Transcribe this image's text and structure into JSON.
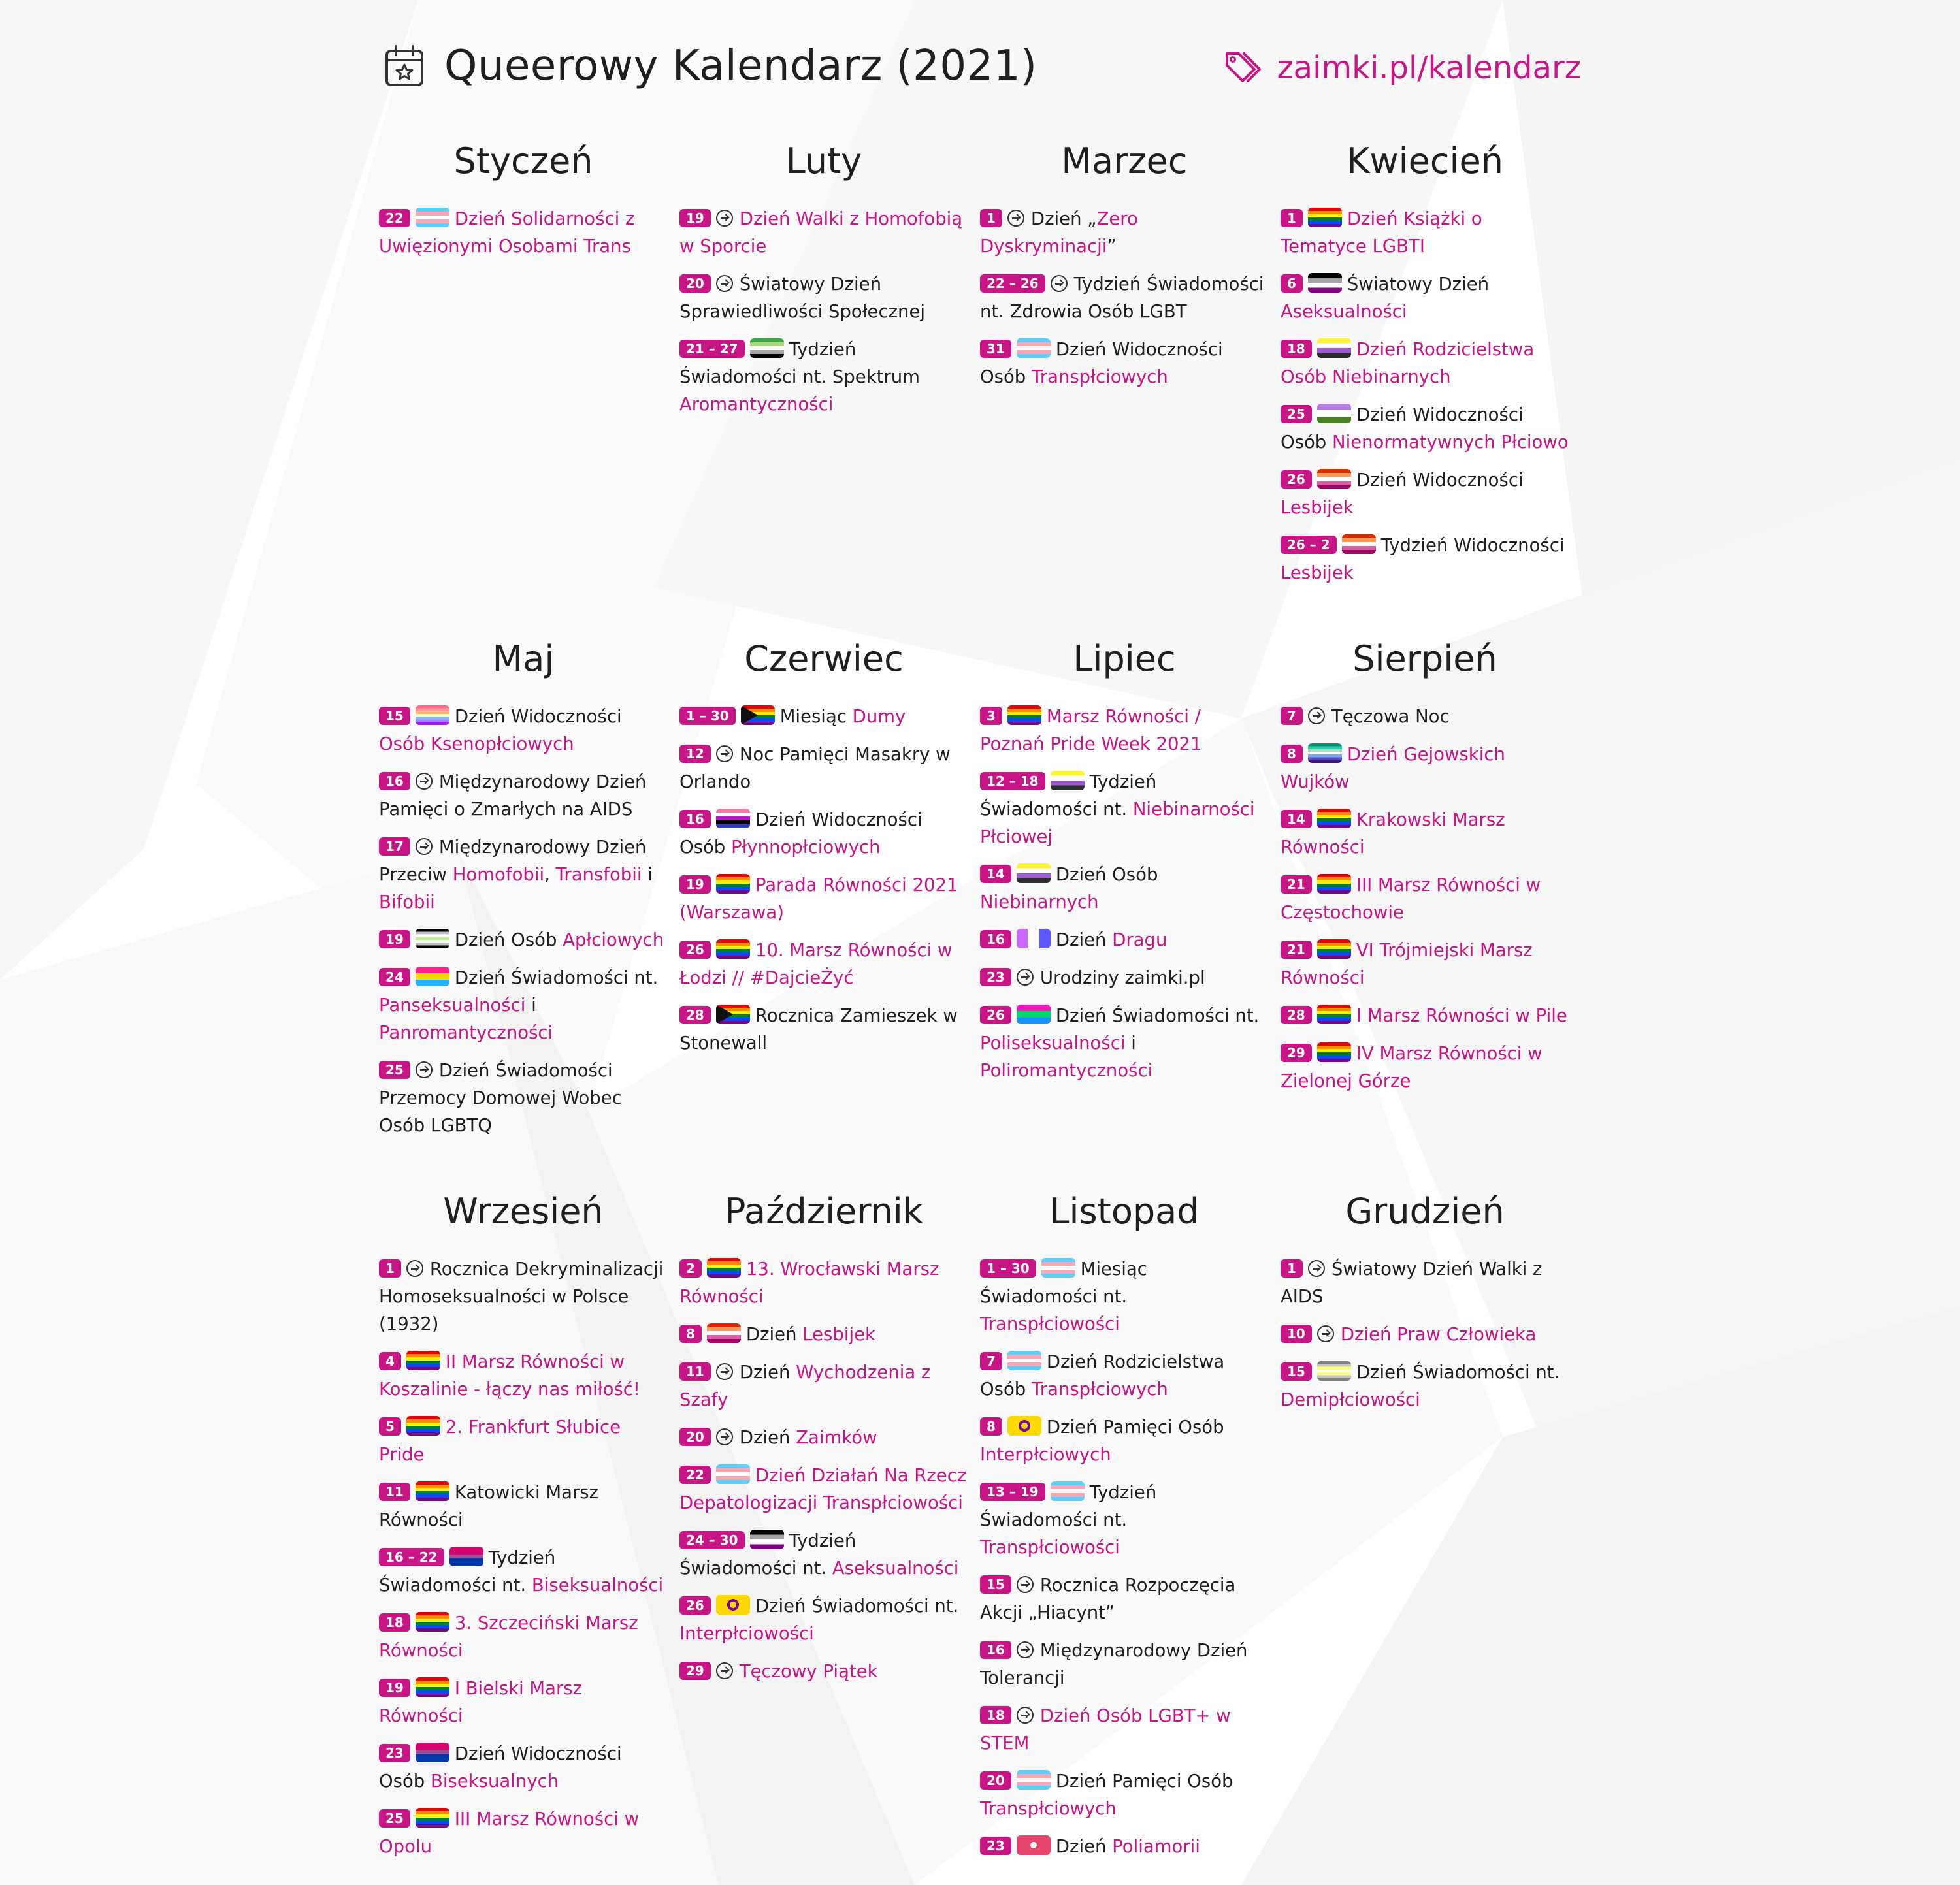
{
  "header": {
    "title": "Queerowy Kalendarz (2021)",
    "site": "zaimki.pl/kalendarz",
    "calendar_icon": "calendar-star-icon",
    "tag_icon": "tags-icon"
  },
  "colors": {
    "accent": "#c71585",
    "text": "#1f1f1f",
    "badge_text": "#ffffff"
  },
  "months": [
    {
      "name": "Styczeń",
      "events": [
        {
          "date": "22",
          "flag": "trans",
          "parts": [
            {
              "t": "Dzień Solidarności z Uwięzionymi Osobami Trans",
              "link": true
            }
          ]
        }
      ]
    },
    {
      "name": "Luty",
      "events": [
        {
          "date": "19",
          "flag": "arrow",
          "parts": [
            {
              "t": "Dzień Walki z Homofobią w Sporcie",
              "link": true
            }
          ]
        },
        {
          "date": "20",
          "flag": "arrow",
          "parts": [
            {
              "t": "Światowy Dzień Sprawiedliwości Społecznej",
              "link": false
            }
          ]
        },
        {
          "date": "21 – 27",
          "flag": "aromantic",
          "parts": [
            {
              "t": "Tydzień Świadomości nt. Spektrum ",
              "link": false
            },
            {
              "t": "Aromantyczności",
              "link": true
            }
          ]
        }
      ]
    },
    {
      "name": "Marzec",
      "events": [
        {
          "date": "1",
          "flag": "arrow",
          "parts": [
            {
              "t": "Dzień „",
              "link": false
            },
            {
              "t": "Zero Dyskryminacji",
              "link": true
            },
            {
              "t": "”",
              "link": false
            }
          ]
        },
        {
          "date": "22 – 26",
          "flag": "arrow",
          "parts": [
            {
              "t": "Tydzień Świadomości nt. Zdrowia Osób LGBT",
              "link": false
            }
          ]
        },
        {
          "date": "31",
          "flag": "trans",
          "parts": [
            {
              "t": "Dzień Widoczności Osób ",
              "link": false
            },
            {
              "t": "Transpłciowych",
              "link": true
            }
          ]
        }
      ]
    },
    {
      "name": "Kwiecień",
      "events": [
        {
          "date": "1",
          "flag": "rainbow",
          "parts": [
            {
              "t": "Dzień Książki o Tematyce LGBTI",
              "link": true
            }
          ]
        },
        {
          "date": "6",
          "flag": "asexual",
          "parts": [
            {
              "t": "Światowy Dzień ",
              "link": false
            },
            {
              "t": "Aseksualności",
              "link": true
            }
          ]
        },
        {
          "date": "18",
          "flag": "nonbinary",
          "parts": [
            {
              "t": "Dzień Rodzicielstwa Osób Niebinarnych",
              "link": true
            }
          ]
        },
        {
          "date": "25",
          "flag": "genderqueer",
          "parts": [
            {
              "t": "Dzień Widoczności Osób ",
              "link": false
            },
            {
              "t": "Nienormatywnych Płciowo",
              "link": true
            }
          ]
        },
        {
          "date": "26",
          "flag": "lesbian",
          "parts": [
            {
              "t": "Dzień Widoczności ",
              "link": false
            },
            {
              "t": "Lesbijek",
              "link": true
            }
          ]
        },
        {
          "date": "26 – 2",
          "flag": "lesbian",
          "parts": [
            {
              "t": "Tydzień Widoczności ",
              "link": false
            },
            {
              "t": "Lesbijek",
              "link": true
            }
          ]
        }
      ]
    },
    {
      "name": "Maj",
      "events": [
        {
          "date": "15",
          "flag": "xenogender",
          "parts": [
            {
              "t": "Dzień Widoczności ",
              "link": false
            },
            {
              "t": "Osób Ksenopłciowych",
              "link": true
            }
          ]
        },
        {
          "date": "16",
          "flag": "arrow",
          "parts": [
            {
              "t": "Międzynarodowy Dzień Pamięci o Zmarłych na AIDS",
              "link": false
            }
          ]
        },
        {
          "date": "17",
          "flag": "arrow",
          "parts": [
            {
              "t": "Międzynarodowy Dzień Przeciw ",
              "link": false
            },
            {
              "t": "Homofobii",
              "link": true
            },
            {
              "t": ", ",
              "link": false
            },
            {
              "t": "Transfobii",
              "link": true
            },
            {
              "t": " i ",
              "link": false
            },
            {
              "t": "Bifobii",
              "link": true
            }
          ]
        },
        {
          "date": "19",
          "flag": "agender",
          "parts": [
            {
              "t": "Dzień Osób ",
              "link": false
            },
            {
              "t": "Apłciowych",
              "link": true
            }
          ]
        },
        {
          "date": "24",
          "flag": "pansexual",
          "parts": [
            {
              "t": "Dzień Świadomości nt. ",
              "link": false
            },
            {
              "t": "Panseksualności",
              "link": true
            },
            {
              "t": " i ",
              "link": false
            },
            {
              "t": "Panromantyczności",
              "link": true
            }
          ]
        },
        {
          "date": "25",
          "flag": "arrow",
          "parts": [
            {
              "t": "Dzień Świadomości Przemocy Domowej Wobec Osób LGBTQ",
              "link": false
            }
          ]
        }
      ]
    },
    {
      "name": "Czerwiec",
      "events": [
        {
          "date": "1 – 30",
          "flag": "progress",
          "parts": [
            {
              "t": "Miesiąc ",
              "link": false
            },
            {
              "t": "Dumy",
              "link": true
            }
          ]
        },
        {
          "date": "12",
          "flag": "arrow",
          "parts": [
            {
              "t": "Noc Pamięci Masakry w Orlando",
              "link": false
            }
          ]
        },
        {
          "date": "16",
          "flag": "genderfluid",
          "parts": [
            {
              "t": "Dzień Widoczności Osób ",
              "link": false
            },
            {
              "t": "Płynnopłciowych",
              "link": true
            }
          ]
        },
        {
          "date": "19",
          "flag": "rainbow",
          "parts": [
            {
              "t": "Parada Równości 2021 (Warszawa)",
              "link": true
            }
          ]
        },
        {
          "date": "26",
          "flag": "rainbow",
          "parts": [
            {
              "t": "10. Marsz Równości w Łodzi // #DajcieŻyć",
              "link": true
            }
          ]
        },
        {
          "date": "28",
          "flag": "progress",
          "parts": [
            {
              "t": "Rocznica Zamieszek w Stonewall",
              "link": false
            }
          ]
        }
      ]
    },
    {
      "name": "Lipiec",
      "events": [
        {
          "date": "3",
          "flag": "rainbow",
          "parts": [
            {
              "t": "Marsz Równości / Poznań Pride Week 2021",
              "link": true
            }
          ]
        },
        {
          "date": "12 – 18",
          "flag": "nonbinary",
          "parts": [
            {
              "t": "Tydzień Świadomości nt. ",
              "link": false
            },
            {
              "t": "Niebinarności Płciowej",
              "link": true
            }
          ]
        },
        {
          "date": "14",
          "flag": "nonbinary",
          "parts": [
            {
              "t": "Dzień Osób ",
              "link": false
            },
            {
              "t": "Niebinarnych",
              "link": true
            }
          ]
        },
        {
          "date": "16",
          "flag": "drag",
          "parts": [
            {
              "t": "Dzień ",
              "link": false
            },
            {
              "t": "Dragu",
              "link": true
            }
          ]
        },
        {
          "date": "23",
          "flag": "arrow",
          "parts": [
            {
              "t": "Urodziny zaimki.pl",
              "link": false
            }
          ]
        },
        {
          "date": "26",
          "flag": "polysexual",
          "parts": [
            {
              "t": "Dzień Świadomości nt. ",
              "link": false
            },
            {
              "t": "Poliseksualności",
              "link": true
            },
            {
              "t": " i ",
              "link": false
            },
            {
              "t": "Poliromantyczności",
              "link": true
            }
          ]
        }
      ]
    },
    {
      "name": "Sierpień",
      "events": [
        {
          "date": "7",
          "flag": "arrow",
          "parts": [
            {
              "t": "Tęczowa Noc",
              "link": false
            }
          ]
        },
        {
          "date": "8",
          "flag": "gay",
          "parts": [
            {
              "t": "Dzień Gejowskich Wujków",
              "link": true
            }
          ]
        },
        {
          "date": "14",
          "flag": "rainbow",
          "parts": [
            {
              "t": "Krakowski Marsz Równości",
              "link": true
            }
          ]
        },
        {
          "date": "21",
          "flag": "rainbow",
          "parts": [
            {
              "t": "III Marsz Równości w Częstochowie",
              "link": true
            }
          ]
        },
        {
          "date": "21",
          "flag": "rainbow",
          "parts": [
            {
              "t": "VI Trójmiejski Marsz Równości",
              "link": true
            }
          ]
        },
        {
          "date": "28",
          "flag": "rainbow",
          "parts": [
            {
              "t": "I Marsz Równości w Pile",
              "link": true
            }
          ]
        },
        {
          "date": "29",
          "flag": "rainbow",
          "parts": [
            {
              "t": "IV Marsz Równości w Zielonej Górze",
              "link": true
            }
          ]
        }
      ]
    },
    {
      "name": "Wrzesień",
      "events": [
        {
          "date": "1",
          "flag": "arrow",
          "parts": [
            {
              "t": "Rocznica Dekryminalizacji Homoseksualności w Polsce (1932)",
              "link": false
            }
          ]
        },
        {
          "date": "4",
          "flag": "rainbow",
          "parts": [
            {
              "t": "II Marsz Równości w Koszalinie - łączy nas miłość!",
              "link": true
            }
          ]
        },
        {
          "date": "5",
          "flag": "rainbow",
          "parts": [
            {
              "t": "2. Frankfurt Słubice Pride",
              "link": true
            }
          ]
        },
        {
          "date": "11",
          "flag": "rainbow",
          "parts": [
            {
              "t": "Katowicki Marsz Równości",
              "link": false
            }
          ]
        },
        {
          "date": "16 – 22",
          "flag": "bisexual",
          "parts": [
            {
              "t": "Tydzień Świadomości nt. ",
              "link": false
            },
            {
              "t": "Biseksualności",
              "link": true
            }
          ]
        },
        {
          "date": "18",
          "flag": "rainbow",
          "parts": [
            {
              "t": "3. Szczeciński Marsz Równości",
              "link": true
            }
          ]
        },
        {
          "date": "19",
          "flag": "rainbow",
          "parts": [
            {
              "t": "I Bielski Marsz Równości",
              "link": true
            }
          ]
        },
        {
          "date": "23",
          "flag": "bisexual",
          "parts": [
            {
              "t": "Dzień Widoczności Osób ",
              "link": false
            },
            {
              "t": "Biseksualnych",
              "link": true
            }
          ]
        },
        {
          "date": "25",
          "flag": "rainbow",
          "parts": [
            {
              "t": "III Marsz Równości w Opolu",
              "link": true
            }
          ]
        }
      ]
    },
    {
      "name": "Październik",
      "events": [
        {
          "date": "2",
          "flag": "rainbow",
          "parts": [
            {
              "t": "13. Wrocławski Marsz Równości",
              "link": true
            }
          ]
        },
        {
          "date": "8",
          "flag": "lesbian",
          "parts": [
            {
              "t": "Dzień ",
              "link": false
            },
            {
              "t": "Lesbijek",
              "link": true
            }
          ]
        },
        {
          "date": "11",
          "flag": "arrow",
          "parts": [
            {
              "t": "Dzień ",
              "link": false
            },
            {
              "t": "Wychodzenia z Szafy",
              "link": true
            }
          ]
        },
        {
          "date": "20",
          "flag": "arrow",
          "parts": [
            {
              "t": "Dzień ",
              "link": false
            },
            {
              "t": "Zaimków",
              "link": true
            }
          ]
        },
        {
          "date": "22",
          "flag": "trans",
          "parts": [
            {
              "t": "Dzień Działań Na Rzecz Depatologizacji Transpłciowości",
              "link": true
            }
          ]
        },
        {
          "date": "24 – 30",
          "flag": "asexual",
          "parts": [
            {
              "t": "Tydzień Świadomości nt. ",
              "link": false
            },
            {
              "t": "Aseksualności",
              "link": true
            }
          ]
        },
        {
          "date": "26",
          "flag": "intersex",
          "parts": [
            {
              "t": "Dzień Świadomości nt. ",
              "link": false
            },
            {
              "t": "Interpłciowości",
              "link": true
            }
          ]
        },
        {
          "date": "29",
          "flag": "arrow",
          "parts": [
            {
              "t": "Tęczowy Piątek",
              "link": true
            }
          ]
        }
      ]
    },
    {
      "name": "Listopad",
      "events": [
        {
          "date": "1 – 30",
          "flag": "trans",
          "parts": [
            {
              "t": "Miesiąc Świadomości nt. ",
              "link": false
            },
            {
              "t": "Transpłciowości",
              "link": true
            }
          ]
        },
        {
          "date": "7",
          "flag": "trans",
          "parts": [
            {
              "t": "Dzień Rodzicielstwa Osób ",
              "link": false
            },
            {
              "t": "Transpłciowych",
              "link": true
            }
          ]
        },
        {
          "date": "8",
          "flag": "intersex",
          "parts": [
            {
              "t": "Dzień Pamięci Osób ",
              "link": false
            },
            {
              "t": "Interpłciowych",
              "link": true
            }
          ]
        },
        {
          "date": "13 – 19",
          "flag": "trans",
          "parts": [
            {
              "t": "Tydzień Świadomości nt. ",
              "link": false
            },
            {
              "t": "Transpłciowości",
              "link": true
            }
          ]
        },
        {
          "date": "15",
          "flag": "arrow",
          "parts": [
            {
              "t": "Rocznica Rozpoczęcia Akcji „Hiacynt”",
              "link": false
            }
          ]
        },
        {
          "date": "16",
          "flag": "arrow",
          "parts": [
            {
              "t": "Międzynarodowy Dzień Tolerancji",
              "link": false
            }
          ]
        },
        {
          "date": "18",
          "flag": "arrow",
          "parts": [
            {
              "t": "Dzień Osób LGBT+ w STEM",
              "link": true
            }
          ]
        },
        {
          "date": "20",
          "flag": "trans",
          "parts": [
            {
              "t": "Dzień Pamięci Osób ",
              "link": false
            },
            {
              "t": "Transpłciowych",
              "link": true
            }
          ]
        },
        {
          "date": "23",
          "flag": "polyamory",
          "parts": [
            {
              "t": "Dzień ",
              "link": false
            },
            {
              "t": "Poliamorii",
              "link": true
            }
          ]
        }
      ]
    },
    {
      "name": "Grudzień",
      "events": [
        {
          "date": "1",
          "flag": "arrow",
          "parts": [
            {
              "t": "Światowy Dzień Walki z AIDS",
              "link": false
            }
          ]
        },
        {
          "date": "10",
          "flag": "arrow",
          "parts": [
            {
              "t": "Dzień Praw Człowieka",
              "link": true
            }
          ]
        },
        {
          "date": "15",
          "flag": "demigender",
          "parts": [
            {
              "t": "Dzień Świadomości nt. ",
              "link": false
            },
            {
              "t": "Demipłciowości",
              "link": true
            }
          ]
        }
      ]
    }
  ]
}
